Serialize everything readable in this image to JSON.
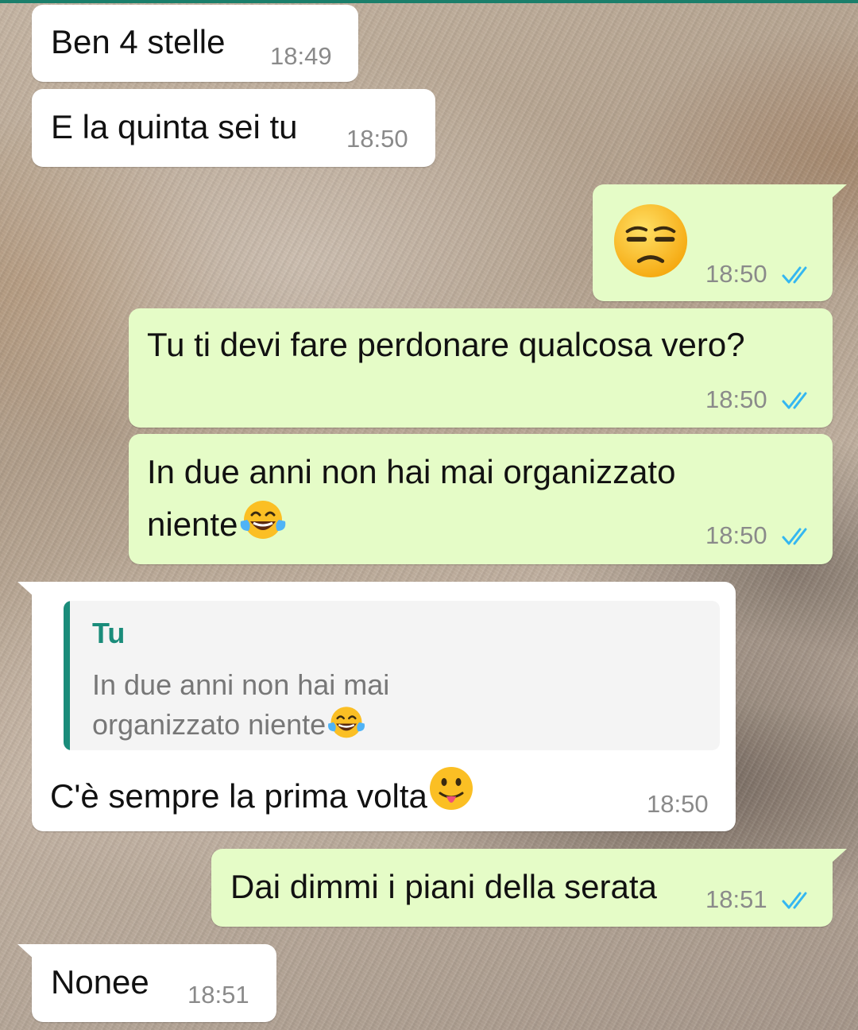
{
  "colors": {
    "incoming_bubble": "#ffffff",
    "outgoing_bubble": "#e5fcc7",
    "read_ticks": "#34b7f1",
    "quote_accent": "#1a8c7a"
  },
  "messages": [
    {
      "direction": "incoming",
      "text": "Ben 4 stelle",
      "time": "18:49"
    },
    {
      "direction": "incoming",
      "text": "E la quinta sei tu",
      "time": "18:50"
    },
    {
      "direction": "outgoing",
      "emoji": "unamused-face",
      "time": "18:50",
      "status": "read"
    },
    {
      "direction": "outgoing",
      "text": "Tu ti devi fare perdonare qualcosa vero?",
      "time": "18:50",
      "status": "read"
    },
    {
      "direction": "outgoing",
      "text_line1": "In due anni non hai mai organizzato",
      "text_line2": "niente",
      "emoji": "tears-of-joy",
      "time": "18:50",
      "status": "read"
    },
    {
      "direction": "incoming",
      "quote": {
        "author": "Tu",
        "line1": "In due anni non hai mai",
        "line2": "organizzato niente",
        "emoji": "tears-of-joy"
      },
      "text": "C'è sempre la prima volta",
      "emoji": "tongue-out",
      "time": "18:50"
    },
    {
      "direction": "outgoing",
      "text": "Dai dimmi i piani della serata",
      "time": "18:51",
      "status": "read"
    },
    {
      "direction": "incoming",
      "text": "Nonee",
      "time": "18:51"
    }
  ]
}
